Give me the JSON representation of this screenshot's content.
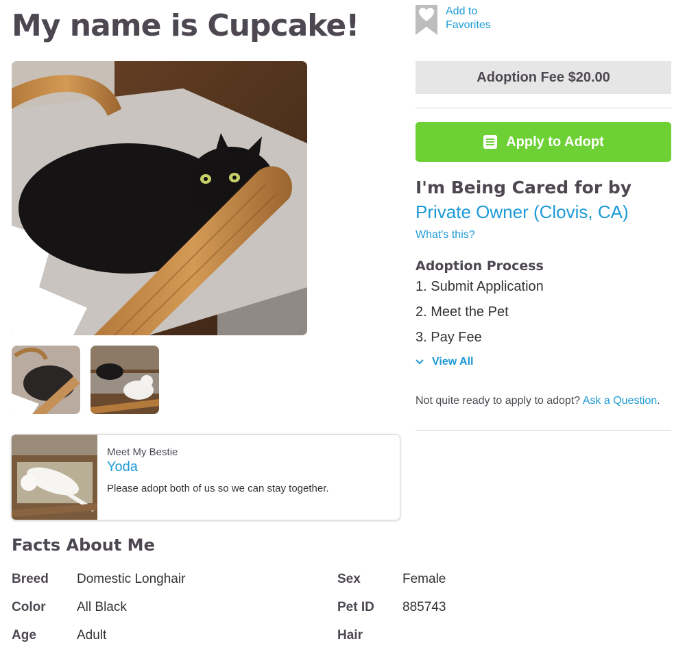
{
  "pet": {
    "title": "My name is Cupcake!",
    "photo_alt": "Cupcake photo"
  },
  "favorites": {
    "line1": "Add to",
    "line2": "Favorites",
    "icon": "heart-bookmark-icon"
  },
  "adoption_fee": "Adoption Fee $20.00",
  "apply_button": {
    "label": "Apply to Adopt",
    "icon": "document-icon"
  },
  "cared_for": {
    "heading": "I'm Being Cared for by",
    "owner": "Private Owner (Clovis, CA)",
    "whats_this": "What's this?"
  },
  "adoption_process": {
    "heading": "Adoption Process",
    "steps": [
      "1. Submit Application",
      "2. Meet the Pet",
      "3. Pay Fee"
    ],
    "view_all": "View All"
  },
  "not_ready": {
    "text": "Not quite ready to apply to adopt?",
    "link": "Ask a Question",
    "period": "."
  },
  "bestie": {
    "small_label": "Meet My Bestie",
    "name": "Yoda",
    "text": "Please adopt both of us so we can stay together."
  },
  "facts": {
    "heading": "Facts About Me",
    "left": [
      {
        "label": "Breed",
        "value": "Domestic Longhair"
      },
      {
        "label": "Color",
        "value": "All Black"
      },
      {
        "label": "Age",
        "value": "Adult"
      }
    ],
    "right": [
      {
        "label": "Sex",
        "value": "Female"
      },
      {
        "label": "Pet ID",
        "value": "885743"
      },
      {
        "label": "Hair",
        "value": ""
      }
    ]
  },
  "colors": {
    "link": "#1d9ad6",
    "apply_green": "#6dd135",
    "heading": "#4d4751",
    "fee_bg": "#e6e6e6"
  }
}
